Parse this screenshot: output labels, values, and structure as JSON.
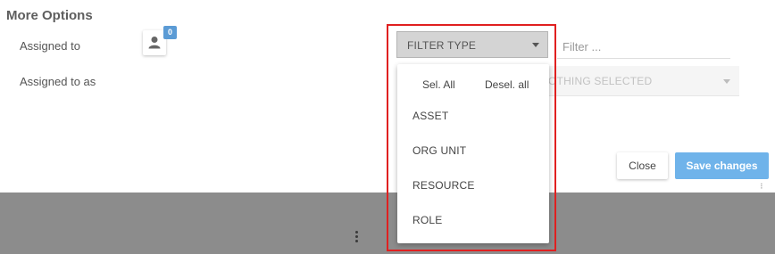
{
  "dialog": {
    "title": "More Options",
    "assigned_to_label": "Assigned to",
    "assigned_to_as_label": "Assigned to as",
    "assigned_count": "0",
    "filter_type_label": "FILTER TYPE",
    "filter_placeholder": "Filter ...",
    "nothing_selected": "OTHING SELECTED",
    "dropdown": {
      "select_all": "Sel. All",
      "deselect_all": "Desel. all",
      "options": [
        "ASSET",
        "ORG UNIT",
        "RESOURCE",
        "ROLE"
      ]
    },
    "close_label": "Close",
    "save_label": "Save changes"
  },
  "colors": {
    "accent": "#6fb3ea",
    "badge": "#5b9bd5",
    "highlight": "#e02020",
    "backdrop": "#8c8c8c"
  },
  "icons": {
    "user": "user-icon",
    "caret": "chevron-down-icon",
    "kebab": "more-vertical-icon"
  }
}
